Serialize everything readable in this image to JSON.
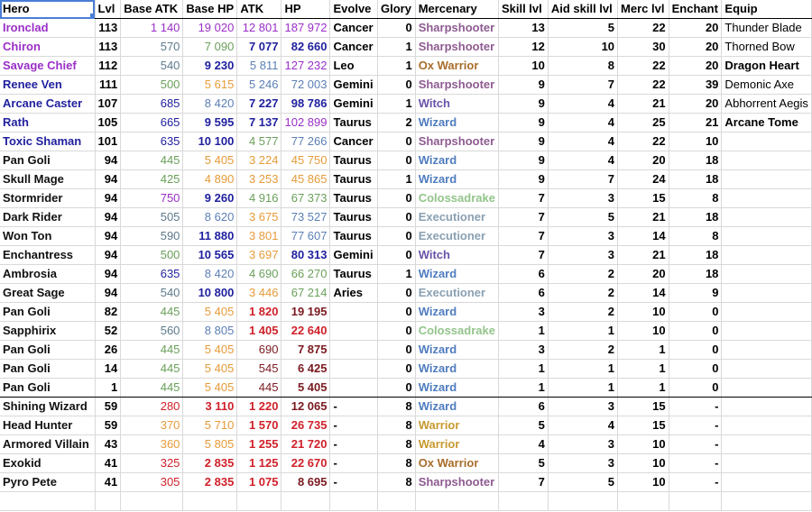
{
  "columns": [
    "Hero",
    "Lvl",
    "Base ATK",
    "Base HP",
    "ATK",
    "HP",
    "Evolve",
    "Glory",
    "Mercenary",
    "Skill lvl",
    "Aid skill lvl",
    "Merc lvl",
    "Enchant",
    "Equip"
  ],
  "colors": {
    "purple": "#9a2fc7",
    "navy": "#1f1f9e",
    "blue": "#5b7fb5",
    "slate": "#5e7a8c",
    "green": "#6aa05a",
    "orange": "#e69b3a",
    "red": "#d0212a",
    "darkred": "#7a1a20",
    "selection": "#4a7ed6"
  },
  "rows": [
    {
      "hero": "Ironclad",
      "hc": "purple",
      "lvl": "113",
      "batk": "1 140",
      "batk_c": "purple",
      "bhp": "19 020",
      "bhp_c": "purple",
      "atk": "12 801",
      "atk_c": "purple",
      "hp": "187 972",
      "hp_c": "purple",
      "evolve": "Cancer",
      "glory": "0",
      "merc": "Sharpshooter",
      "mc": "sharp",
      "skill": "13",
      "aid": "5",
      "merclvl": "22",
      "enchant": "20",
      "equip": "Thunder Blade",
      "equip_bold": false
    },
    {
      "hero": "Chiron",
      "hc": "purple",
      "lvl": "113",
      "batk": "570",
      "batk_c": "slate",
      "bhp": "7 090",
      "bhp_c": "green",
      "atk": "7 077",
      "atk_c": "navy",
      "hp": "82 660",
      "hp_c": "navy",
      "evolve": "Cancer",
      "glory": "1",
      "merc": "Sharpshooter",
      "mc": "sharp",
      "skill": "12",
      "aid": "10",
      "merclvl": "30",
      "enchant": "20",
      "equip": "Thorned Bow",
      "equip_bold": false
    },
    {
      "hero": "Savage Chief",
      "hc": "purple",
      "lvl": "112",
      "batk": "540",
      "batk_c": "slate",
      "bhp": "9 230",
      "bhp_c": "navy",
      "atk": "5 811",
      "atk_c": "blue",
      "hp": "127 232",
      "hp_c": "purple",
      "evolve": "Leo",
      "glory": "1",
      "merc": "Ox Warrior",
      "mc": "ox",
      "skill": "10",
      "aid": "8",
      "merclvl": "22",
      "enchant": "20",
      "equip": "Dragon Heart",
      "equip_bold": true
    },
    {
      "hero": "Renee Ven",
      "hc": "navy",
      "lvl": "111",
      "batk": "500",
      "batk_c": "green",
      "bhp": "5 615",
      "bhp_c": "orange",
      "atk": "5 246",
      "atk_c": "blue",
      "hp": "72 003",
      "hp_c": "blue",
      "evolve": "Gemini",
      "glory": "0",
      "merc": "Sharpshooter",
      "mc": "sharp",
      "skill": "9",
      "aid": "7",
      "merclvl": "22",
      "enchant": "39",
      "equip": "Demonic Axe",
      "equip_bold": false
    },
    {
      "hero": "Arcane Caster",
      "hc": "navy",
      "lvl": "107",
      "batk": "685",
      "batk_c": "navy",
      "bhp": "8 420",
      "bhp_c": "blue",
      "atk": "7 227",
      "atk_c": "navy",
      "hp": "98 786",
      "hp_c": "navy",
      "evolve": "Gemini",
      "glory": "1",
      "merc": "Witch",
      "mc": "witch",
      "skill": "9",
      "aid": "4",
      "merclvl": "21",
      "enchant": "20",
      "equip": "Abhorrent Aegis",
      "equip_bold": false
    },
    {
      "hero": "Rath",
      "hc": "navy",
      "lvl": "105",
      "batk": "665",
      "batk_c": "navy",
      "bhp": "9 595",
      "bhp_c": "navy",
      "atk": "7 137",
      "atk_c": "navy",
      "hp": "102 899",
      "hp_c": "purple",
      "evolve": "Taurus",
      "glory": "2",
      "merc": "Wizard",
      "mc": "wizard",
      "skill": "9",
      "aid": "4",
      "merclvl": "25",
      "enchant": "21",
      "equip": "Arcane Tome",
      "equip_bold": true
    },
    {
      "hero": "Toxic Shaman",
      "hc": "navy",
      "lvl": "101",
      "batk": "635",
      "batk_c": "navy",
      "bhp": "10 100",
      "bhp_c": "navy",
      "atk": "4 577",
      "atk_c": "green",
      "hp": "77 266",
      "hp_c": "blue",
      "evolve": "Cancer",
      "glory": "0",
      "merc": "Sharpshooter",
      "mc": "sharp",
      "skill": "9",
      "aid": "4",
      "merclvl": "22",
      "enchant": "10",
      "equip": "",
      "equip_bold": false
    },
    {
      "hero": "Pan Goli",
      "hc": "black",
      "lvl": "94",
      "batk": "445",
      "batk_c": "green",
      "bhp": "5 405",
      "bhp_c": "orange",
      "atk": "3 224",
      "atk_c": "orange",
      "hp": "45 750",
      "hp_c": "orange",
      "evolve": "Taurus",
      "glory": "0",
      "merc": "Wizard",
      "mc": "wizard",
      "skill": "9",
      "aid": "4",
      "merclvl": "20",
      "enchant": "18",
      "equip": "",
      "equip_bold": false
    },
    {
      "hero": "Skull Mage",
      "hc": "black",
      "lvl": "94",
      "batk": "425",
      "batk_c": "green",
      "bhp": "4 890",
      "bhp_c": "orange",
      "atk": "3 253",
      "atk_c": "orange",
      "hp": "45 865",
      "hp_c": "orange",
      "evolve": "Taurus",
      "glory": "1",
      "merc": "Wizard",
      "mc": "wizard",
      "skill": "9",
      "aid": "7",
      "merclvl": "24",
      "enchant": "18",
      "equip": "",
      "equip_bold": false
    },
    {
      "hero": "Stormrider",
      "hc": "black",
      "lvl": "94",
      "batk": "750",
      "batk_c": "purple",
      "bhp": "9 260",
      "bhp_c": "navy",
      "atk": "4 916",
      "atk_c": "green",
      "hp": "67 373",
      "hp_c": "green",
      "evolve": "Taurus",
      "glory": "0",
      "merc": "Colossadrake",
      "mc": "colossa",
      "skill": "7",
      "aid": "3",
      "merclvl": "15",
      "enchant": "8",
      "equip": "",
      "equip_bold": false
    },
    {
      "hero": "Dark Rider",
      "hc": "black",
      "lvl": "94",
      "batk": "505",
      "batk_c": "slate",
      "bhp": "8 620",
      "bhp_c": "blue",
      "atk": "3 675",
      "atk_c": "orange",
      "hp": "73 527",
      "hp_c": "blue",
      "evolve": "Taurus",
      "glory": "0",
      "merc": "Executioner",
      "mc": "exec",
      "skill": "7",
      "aid": "5",
      "merclvl": "21",
      "enchant": "18",
      "equip": "",
      "equip_bold": false
    },
    {
      "hero": "Won Ton",
      "hc": "black",
      "lvl": "94",
      "batk": "590",
      "batk_c": "slate",
      "bhp": "11 880",
      "bhp_c": "navy",
      "atk": "3 801",
      "atk_c": "orange",
      "hp": "77 607",
      "hp_c": "blue",
      "evolve": "Taurus",
      "glory": "0",
      "merc": "Executioner",
      "mc": "exec",
      "skill": "7",
      "aid": "3",
      "merclvl": "14",
      "enchant": "8",
      "equip": "",
      "equip_bold": false
    },
    {
      "hero": "Enchantress",
      "hc": "black",
      "lvl": "94",
      "batk": "500",
      "batk_c": "green",
      "bhp": "10 565",
      "bhp_c": "navy",
      "atk": "3 697",
      "atk_c": "orange",
      "hp": "80 313",
      "hp_c": "navy",
      "evolve": "Gemini",
      "glory": "0",
      "merc": "Witch",
      "mc": "witch",
      "skill": "7",
      "aid": "3",
      "merclvl": "21",
      "enchant": "18",
      "equip": "",
      "equip_bold": false
    },
    {
      "hero": "Ambrosia",
      "hc": "black",
      "lvl": "94",
      "batk": "635",
      "batk_c": "navy",
      "bhp": "8 420",
      "bhp_c": "blue",
      "atk": "4 690",
      "atk_c": "green",
      "hp": "66 270",
      "hp_c": "green",
      "evolve": "Taurus",
      "glory": "1",
      "merc": "Wizard",
      "mc": "wizard",
      "skill": "6",
      "aid": "2",
      "merclvl": "20",
      "enchant": "18",
      "equip": "",
      "equip_bold": false
    },
    {
      "hero": "Great Sage",
      "hc": "black",
      "lvl": "94",
      "batk": "540",
      "batk_c": "slate",
      "bhp": "10 800",
      "bhp_c": "navy",
      "atk": "3 446",
      "atk_c": "orange",
      "hp": "67 214",
      "hp_c": "green",
      "evolve": "Aries",
      "glory": "0",
      "merc": "Executioner",
      "mc": "exec",
      "skill": "6",
      "aid": "2",
      "merclvl": "14",
      "enchant": "9",
      "equip": "",
      "equip_bold": false
    },
    {
      "hero": "Pan Goli",
      "hc": "black",
      "lvl": "82",
      "batk": "445",
      "batk_c": "green",
      "bhp": "5 405",
      "bhp_c": "orange",
      "atk": "1 820",
      "atk_c": "red",
      "hp": "19 195",
      "hp_c": "darkred",
      "evolve": "",
      "glory": "0",
      "merc": "Wizard",
      "mc": "wizard",
      "skill": "3",
      "aid": "2",
      "merclvl": "10",
      "enchant": "0",
      "equip": "",
      "equip_bold": false
    },
    {
      "hero": "Sapphirix",
      "hc": "black",
      "lvl": "52",
      "batk": "560",
      "batk_c": "slate",
      "bhp": "8 805",
      "bhp_c": "blue",
      "atk": "1 405",
      "atk_c": "red",
      "hp": "22 640",
      "hp_c": "red",
      "evolve": "",
      "glory": "0",
      "merc": "Colossadrake",
      "mc": "colossa",
      "skill": "1",
      "aid": "1",
      "merclvl": "10",
      "enchant": "0",
      "equip": "",
      "equip_bold": false
    },
    {
      "hero": "Pan Goli",
      "hc": "black",
      "lvl": "26",
      "batk": "445",
      "batk_c": "green",
      "bhp": "5 405",
      "bhp_c": "orange",
      "atk": "690",
      "atk_c": "darkred",
      "hp": "7 875",
      "hp_c": "darkred",
      "evolve": "",
      "glory": "0",
      "merc": "Wizard",
      "mc": "wizard",
      "skill": "3",
      "aid": "2",
      "merclvl": "1",
      "enchant": "0",
      "equip": "",
      "equip_bold": false
    },
    {
      "hero": "Pan Goli",
      "hc": "black",
      "lvl": "14",
      "batk": "445",
      "batk_c": "green",
      "bhp": "5 405",
      "bhp_c": "orange",
      "atk": "545",
      "atk_c": "darkred",
      "hp": "6 425",
      "hp_c": "darkred",
      "evolve": "",
      "glory": "0",
      "merc": "Wizard",
      "mc": "wizard",
      "skill": "1",
      "aid": "1",
      "merclvl": "1",
      "enchant": "0",
      "equip": "",
      "equip_bold": false
    },
    {
      "hero": "Pan Goli",
      "hc": "black",
      "lvl": "1",
      "batk": "445",
      "batk_c": "green",
      "bhp": "5 405",
      "bhp_c": "orange",
      "atk": "445",
      "atk_c": "darkred",
      "hp": "5 405",
      "hp_c": "darkred",
      "evolve": "",
      "glory": "0",
      "merc": "Wizard",
      "mc": "wizard",
      "skill": "1",
      "aid": "1",
      "merclvl": "1",
      "enchant": "0",
      "equip": "",
      "equip_bold": false,
      "separator": true
    },
    {
      "hero": "Shining Wizard",
      "hc": "black",
      "lvl": "59",
      "batk": "280",
      "batk_c": "red",
      "bhp": "3 110",
      "bhp_c": "red",
      "atk": "1 220",
      "atk_c": "red",
      "hp": "12 065",
      "hp_c": "darkred",
      "evolve": "-",
      "glory": "8",
      "merc": "Wizard",
      "mc": "wizard",
      "skill": "6",
      "aid": "3",
      "merclvl": "15",
      "enchant": "-",
      "equip": "",
      "equip_bold": false
    },
    {
      "hero": "Head Hunter",
      "hc": "black",
      "lvl": "59",
      "batk": "370",
      "batk_c": "orange",
      "bhp": "5 710",
      "bhp_c": "orange",
      "atk": "1 570",
      "atk_c": "red",
      "hp": "26 735",
      "hp_c": "red",
      "evolve": "-",
      "glory": "8",
      "merc": "Warrior",
      "mc": "warrior",
      "skill": "5",
      "aid": "4",
      "merclvl": "15",
      "enchant": "-",
      "equip": "",
      "equip_bold": false
    },
    {
      "hero": "Armored Villain",
      "hc": "black",
      "lvl": "43",
      "batk": "360",
      "batk_c": "orange",
      "bhp": "5 805",
      "bhp_c": "orange",
      "atk": "1 255",
      "atk_c": "red",
      "hp": "21 720",
      "hp_c": "red",
      "evolve": "-",
      "glory": "8",
      "merc": "Warrior",
      "mc": "warrior",
      "skill": "4",
      "aid": "3",
      "merclvl": "10",
      "enchant": "-",
      "equip": "",
      "equip_bold": false
    },
    {
      "hero": "Exokid",
      "hc": "black",
      "lvl": "41",
      "batk": "325",
      "batk_c": "red",
      "bhp": "2 835",
      "bhp_c": "red",
      "atk": "1 125",
      "atk_c": "red",
      "hp": "22 670",
      "hp_c": "red",
      "evolve": "-",
      "glory": "8",
      "merc": "Ox Warrior",
      "mc": "ox",
      "skill": "5",
      "aid": "3",
      "merclvl": "10",
      "enchant": "-",
      "equip": "",
      "equip_bold": false
    },
    {
      "hero": "Pyro Pete",
      "hc": "black",
      "lvl": "41",
      "batk": "305",
      "batk_c": "red",
      "bhp": "2 835",
      "bhp_c": "red",
      "atk": "1 075",
      "atk_c": "red",
      "hp": "8 695",
      "hp_c": "darkred",
      "evolve": "-",
      "glory": "8",
      "merc": "Sharpshooter",
      "mc": "sharp",
      "skill": "7",
      "aid": "5",
      "merclvl": "10",
      "enchant": "-",
      "equip": "",
      "equip_bold": false
    }
  ]
}
